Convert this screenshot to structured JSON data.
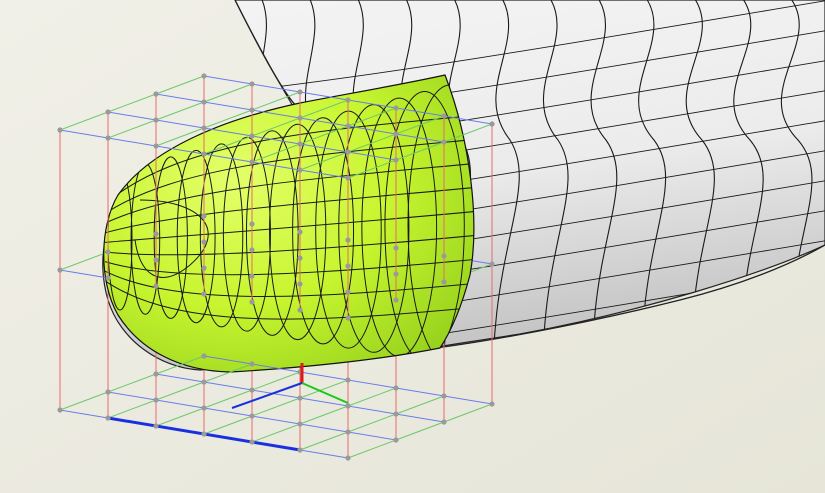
{
  "viewport": {
    "view": "3d-perspective",
    "background_color": "#f1f0e8",
    "background_gradient_color": "#e6e5d8"
  },
  "model": {
    "surface_color": "#ececec",
    "surface_shade_color": "#c4c4c4",
    "wireframe_color": "#1a1a1a",
    "selected_patch_color": "#c7f52f",
    "selected_patch_shade_color": "#8fcd1a"
  },
  "control_lattice": {
    "visible": true,
    "point_color": "#9a9a9a",
    "edge_colors": {
      "x": "#e86a6a",
      "y": "#6ac96a",
      "z": "#6a7de8"
    }
  },
  "axis_gizmo": {
    "visible": true,
    "x_color": "#e01818",
    "y_color": "#18c818",
    "z_color": "#1830e0"
  }
}
